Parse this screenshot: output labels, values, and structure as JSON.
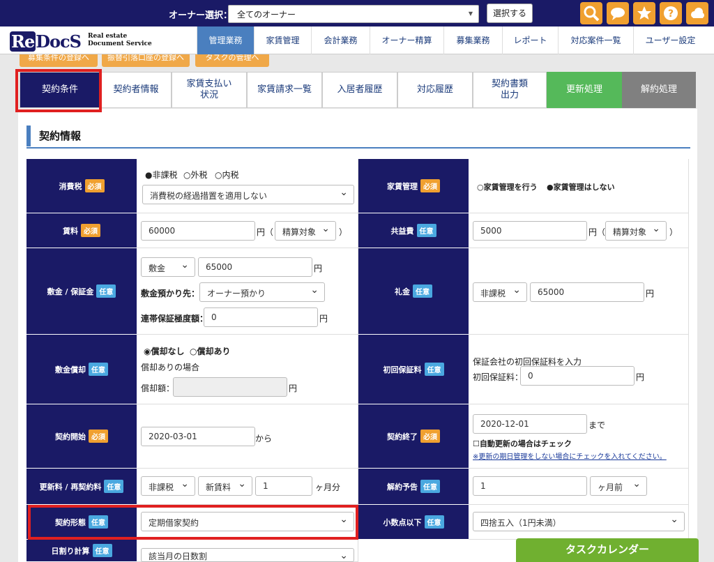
{
  "topbar": {
    "owner_label": "オーナー選択：",
    "owner_value": "全てのオーナー",
    "select_button": "選択する"
  },
  "logo": {
    "re": "Re",
    "docs": "DocS",
    "sub1": "Real estate",
    "sub2": "Document Service"
  },
  "nav": [
    "管理業務",
    "家賃管理",
    "会計業務",
    "オーナー精算",
    "募集業務",
    "レポート",
    "対応案件一覧",
    "ユーザー設定"
  ],
  "orange_buttons": [
    "募集条件の登録へ",
    "振替引落口座の登録へ",
    "タスクの管理へ"
  ],
  "tabs": [
    "契約条件",
    "契約者情報",
    "家賃支払い状況",
    "家賃請求一覧",
    "入居者履歴",
    "対応履歴",
    "契約書類出力",
    "更新処理",
    "解約処理"
  ],
  "tab_lines": {
    "pay1": "家賃支払い",
    "pay2": "状況",
    "doc1": "契約書類",
    "doc2": "出力"
  },
  "section_title": "契約情報",
  "badges": {
    "required": "必須",
    "optional": "任意"
  },
  "form": {
    "tax": {
      "label": "消費税",
      "opt1": "●非課税",
      "opt2": "○外税",
      "opt3": "○内税",
      "select": "消費税の経過措置を適用しない"
    },
    "rent_mgmt": {
      "label": "家賃管理",
      "opt1": "○家賃管理を行う",
      "opt2": "●家賃管理はしない"
    },
    "rent": {
      "label": "賃料",
      "value": "60000",
      "unit": "円（",
      "select": "精算対象",
      "close": "）"
    },
    "common": {
      "label": "共益費",
      "value": "5000",
      "unit": "円（",
      "select": "精算対象",
      "close": "）"
    },
    "deposit": {
      "label": "敷金 / 保証金",
      "type": "敷金",
      "value": "65000",
      "unit": "円",
      "keep_label": "敷金預かり先：",
      "keep_value": "オーナー預かり",
      "limit_label": "連帯保証極度額：",
      "limit_value": "0",
      "limit_unit": "円"
    },
    "key_money": {
      "label": "礼金",
      "tax": "非課税",
      "value": "65000",
      "unit": "円"
    },
    "amort": {
      "label": "敷金償却",
      "opt1": "◉償却なし",
      "opt2": "○償却あり",
      "note": "償却ありの場合",
      "amount_label": "償却額：",
      "unit": "円"
    },
    "guarantee": {
      "label": "初回保証料",
      "note": "保証会社の初回保証料を入力",
      "fee_label": "初回保証料：",
      "value": "0",
      "unit": "円"
    },
    "start": {
      "label": "契約開始",
      "value": "2020-03-01",
      "suffix": "から"
    },
    "end": {
      "label": "契約終了",
      "value": "2020-12-01",
      "suffix": "まで",
      "check": "☐自動更新の場合はチェック",
      "note": "※更新の期日管理をしない場合にチェックを入れてください。"
    },
    "renewal": {
      "label": "更新料 / 再契約料",
      "tax": "非課税",
      "base": "新賃料",
      "value": "1",
      "unit": "ヶ月分"
    },
    "notice": {
      "label": "解約予告",
      "value": "1",
      "unit": "ヶ月前"
    },
    "type": {
      "label": "契約形態",
      "value": "定期借家契約"
    },
    "decimal": {
      "label": "小数点以下",
      "value": "四捨五入（1円未満）"
    },
    "daily": {
      "label": "日割り計算",
      "value": "該当月の日数割"
    }
  },
  "task_calendar": "タスクカレンダー",
  "colors": {
    "navy": "#1a1a66",
    "accent": "#4a7fbf",
    "orange": "#f0a030",
    "green": "#55b95a",
    "red": "#e02020"
  }
}
